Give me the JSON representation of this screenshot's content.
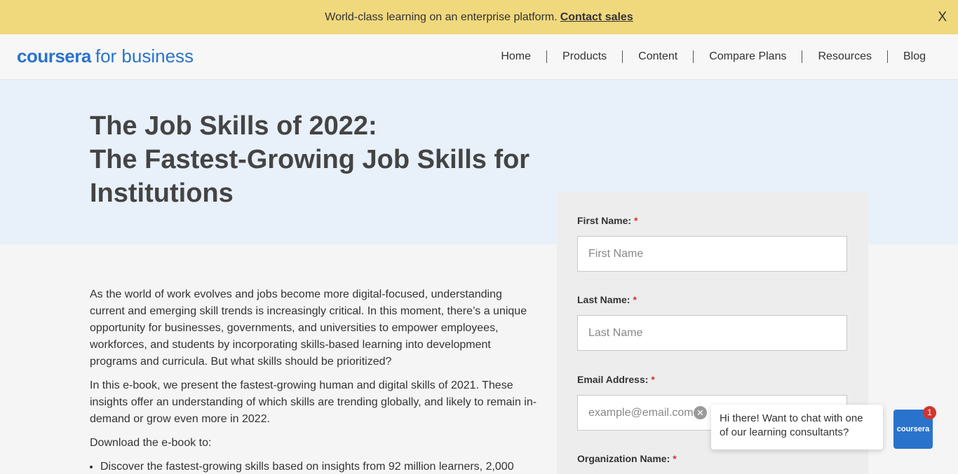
{
  "banner": {
    "text": "World-class learning on an enterprise platform.",
    "link": "Contact sales",
    "close": "X"
  },
  "header": {
    "logo_brand": "coursera",
    "logo_sub": "for business",
    "nav": [
      "Home",
      "Products",
      "Content",
      "Compare Plans",
      "Resources",
      "Blog"
    ]
  },
  "hero": {
    "title_line1": "The Job Skills of 2022:",
    "title_line2": "The Fastest-Growing Job Skills for Institutions"
  },
  "content": {
    "para1": "As the world of work evolves and jobs become more digital-focused, understanding current and emerging skill trends is increasingly critical. In this moment, there’s a unique opportunity for businesses, governments, and universities to empower employees, workforces, and students by incorporating skills-based learning into development programs and curricula. But what skills should be prioritized?",
    "para2": "In this e-book, we present the fastest-growing human and digital skills of 2021. These insights offer an understanding of which skills are trending globally, and likely to remain in-demand or grow even more in 2022.",
    "para3": "Download the e-book to:",
    "bullet1": "Discover the fastest-growing skills based on insights from 92 million learners, 2,000"
  },
  "form": {
    "first_name_label": "First Name:",
    "first_name_placeholder": "First Name",
    "last_name_label": "Last Name:",
    "last_name_placeholder": "Last Name",
    "email_label": "Email Address:",
    "email_placeholder": "example@email.com",
    "org_label": "Organization Name:",
    "required_mark": "*"
  },
  "chat": {
    "message": "Hi there! Want to chat with one of our learning consultants?",
    "launcher_label": "coursera",
    "badge_count": "1"
  },
  "colors": {
    "banner_bg": "#f0d87d",
    "brand_blue": "#2a73cc",
    "hero_bg": "#e8f0fa",
    "required_red": "#d0362f"
  }
}
